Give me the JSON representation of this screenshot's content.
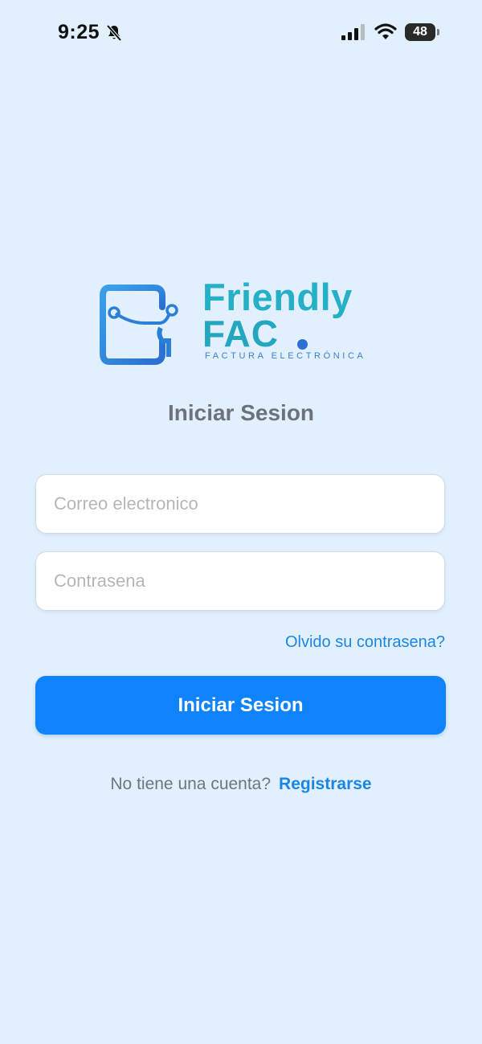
{
  "status_bar": {
    "time": "9:25",
    "battery": "48"
  },
  "logo": {
    "brand_line1": "Friendly",
    "brand_line2": "FAC",
    "tagline": "FACTURA ELECTRÓNICA",
    "colors": {
      "teal": "#25b0c7",
      "blue": "#2e6fd6"
    }
  },
  "title": "Iniciar Sesion",
  "form": {
    "email_placeholder": "Correo electronico",
    "email_value": "",
    "password_placeholder": "Contrasena",
    "password_value": "",
    "forgot_label": "Olvido su contrasena?",
    "submit_label": "Iniciar Sesion"
  },
  "footer": {
    "prompt": "No tiene una cuenta?",
    "register_label": "Registrarse"
  },
  "theme": {
    "background": "#e1f0fc",
    "accent": "#0f83fb",
    "link": "#1b86e6"
  }
}
